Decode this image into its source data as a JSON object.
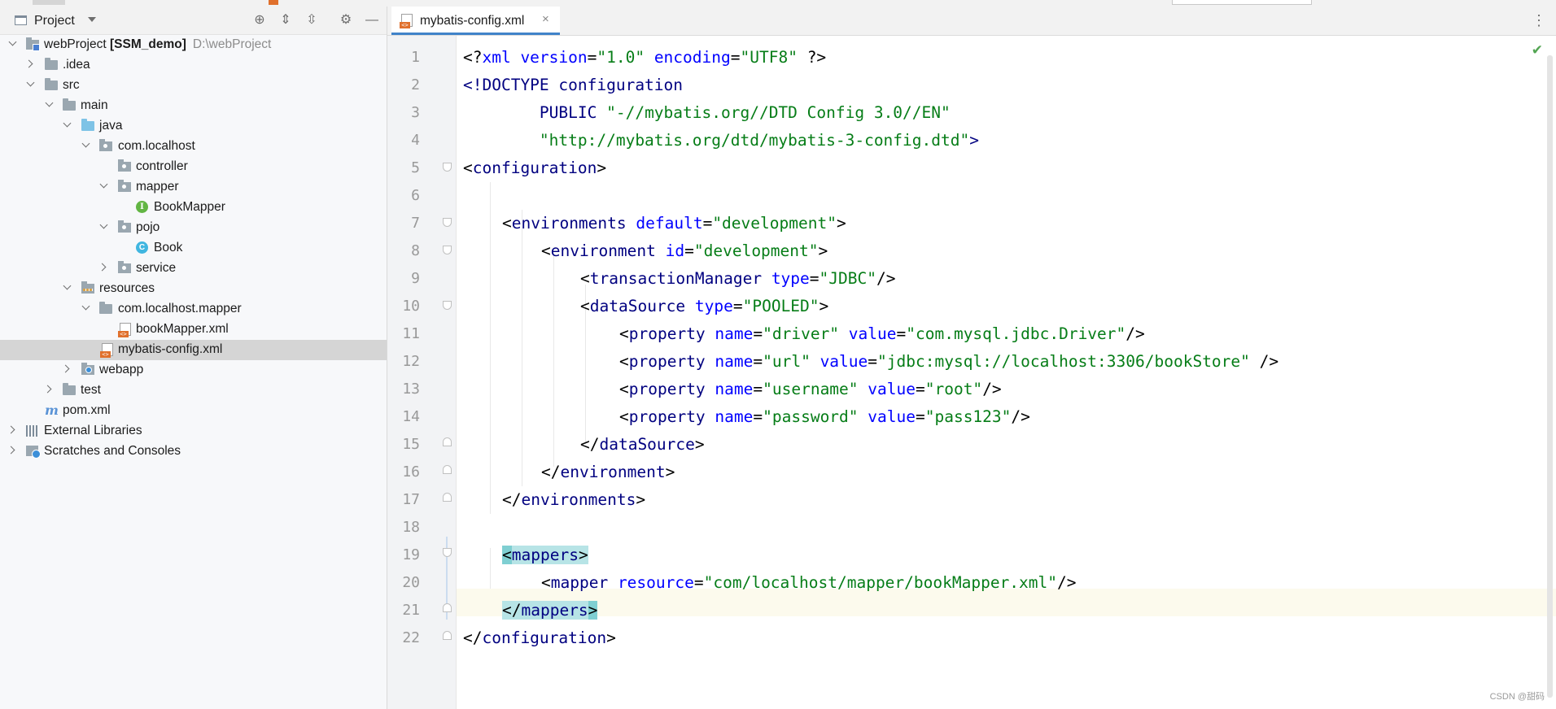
{
  "panel": {
    "title": "Project",
    "icons": [
      "locate-icon",
      "expand-all-icon",
      "collapse-all-icon",
      "gear-icon",
      "minimize-icon"
    ]
  },
  "tree": {
    "root_name": "webProject",
    "root_module": "[SSM_demo]",
    "root_path": "D:\\webProject",
    "items": [
      {
        "label": "webProject",
        "depth": 0
      },
      {
        "label": ".idea",
        "depth": 1
      },
      {
        "label": "src",
        "depth": 1
      },
      {
        "label": "main",
        "depth": 2
      },
      {
        "label": "java",
        "depth": 3
      },
      {
        "label": "com.localhost",
        "depth": 4
      },
      {
        "label": "controller",
        "depth": 5
      },
      {
        "label": "mapper",
        "depth": 5
      },
      {
        "label": "BookMapper",
        "depth": 6
      },
      {
        "label": "pojo",
        "depth": 5
      },
      {
        "label": "Book",
        "depth": 6
      },
      {
        "label": "service",
        "depth": 5
      },
      {
        "label": "resources",
        "depth": 3
      },
      {
        "label": "com.localhost.mapper",
        "depth": 4
      },
      {
        "label": "bookMapper.xml",
        "depth": 5
      },
      {
        "label": "mybatis-config.xml",
        "depth": 4,
        "selected": true
      },
      {
        "label": "webapp",
        "depth": 3
      },
      {
        "label": "test",
        "depth": 2
      },
      {
        "label": "pom.xml",
        "depth": 1
      },
      {
        "label": "External Libraries",
        "depth": 0
      },
      {
        "label": "Scratches and Consoles",
        "depth": 0
      }
    ]
  },
  "editor": {
    "tab_label": "mybatis-config.xml",
    "line_numbers": [
      "1",
      "2",
      "3",
      "4",
      "5",
      "6",
      "7",
      "8",
      "9",
      "10",
      "11",
      "12",
      "13",
      "14",
      "15",
      "16",
      "17",
      "18",
      "19",
      "20",
      "21",
      "22"
    ],
    "current_line": 21
  },
  "code": {
    "l1": {
      "a": "<?",
      "b": "xml version",
      "c": "=",
      "d": "\"1.0\"",
      "e": " encoding",
      "f": "=",
      "g": "\"UTF8\"",
      "h": " ?>"
    },
    "l2": {
      "a": "<!DOCTYPE configuration"
    },
    "l3": {
      "a": "        PUBLIC ",
      "b": "\"-//mybatis.org//DTD Config 3.0//EN\""
    },
    "l4": {
      "a": "        ",
      "b": "\"http://mybatis.org/dtd/mybatis-3-config.dtd\"",
      "c": ">"
    },
    "l5": {
      "a": "<",
      "b": "configuration",
      "c": ">"
    },
    "l7": {
      "a": "<",
      "b": "environments",
      "c": " default",
      "d": "=",
      "e": "\"development\"",
      "f": ">"
    },
    "l8": {
      "a": "<",
      "b": "environment",
      "c": " id",
      "d": "=",
      "e": "\"development\"",
      "f": ">"
    },
    "l9": {
      "a": "<",
      "b": "transactionManager",
      "c": " type",
      "d": "=",
      "e": "\"JDBC\"",
      "f": "/>"
    },
    "l10": {
      "a": "<",
      "b": "dataSource",
      "c": " type",
      "d": "=",
      "e": "\"POOLED\"",
      "f": ">"
    },
    "l11": {
      "a": "<",
      "b": "property",
      "c": " name",
      "d": "=",
      "e": "\"driver\"",
      "f": " value",
      "g": "=",
      "h": "\"com.mysql.jdbc.Driver\"",
      "i": "/>"
    },
    "l12": {
      "a": "<",
      "b": "property",
      "c": " name",
      "d": "=",
      "e": "\"url\"",
      "f": " value",
      "g": "=",
      "h": "\"jdbc:mysql://localhost:3306/bookStore\"",
      "i": " />"
    },
    "l13": {
      "a": "<",
      "b": "property",
      "c": " name",
      "d": "=",
      "e": "\"username\"",
      "f": " value",
      "g": "=",
      "h": "\"root\"",
      "i": "/>"
    },
    "l14": {
      "a": "<",
      "b": "property",
      "c": " name",
      "d": "=",
      "e": "\"password\"",
      "f": " value",
      "g": "=",
      "h": "\"pass123\"",
      "i": "/>"
    },
    "l15": {
      "a": "</",
      "b": "dataSource",
      "c": ">"
    },
    "l16": {
      "a": "</",
      "b": "environment",
      "c": ">"
    },
    "l17": {
      "a": "</",
      "b": "environments",
      "c": ">"
    },
    "l19": {
      "a": "<",
      "b": "mappers",
      "c": ">"
    },
    "l20": {
      "a": "<",
      "b": "mapper",
      "c": " resource",
      "d": "=",
      "e": "\"com/localhost/mapper/bookMapper.xml\"",
      "f": "/>"
    },
    "l21": {
      "a": "</",
      "b": "mappers",
      "c": ">"
    },
    "l22": {
      "a": "</",
      "b": "configuration",
      "c": ">"
    }
  },
  "watermark": "CSDN @甜码",
  "colors": {
    "tag": "#000080",
    "attr": "#0000ff",
    "string": "#067d17",
    "selection": "#d5d5d5",
    "accent": "#4083c9"
  }
}
